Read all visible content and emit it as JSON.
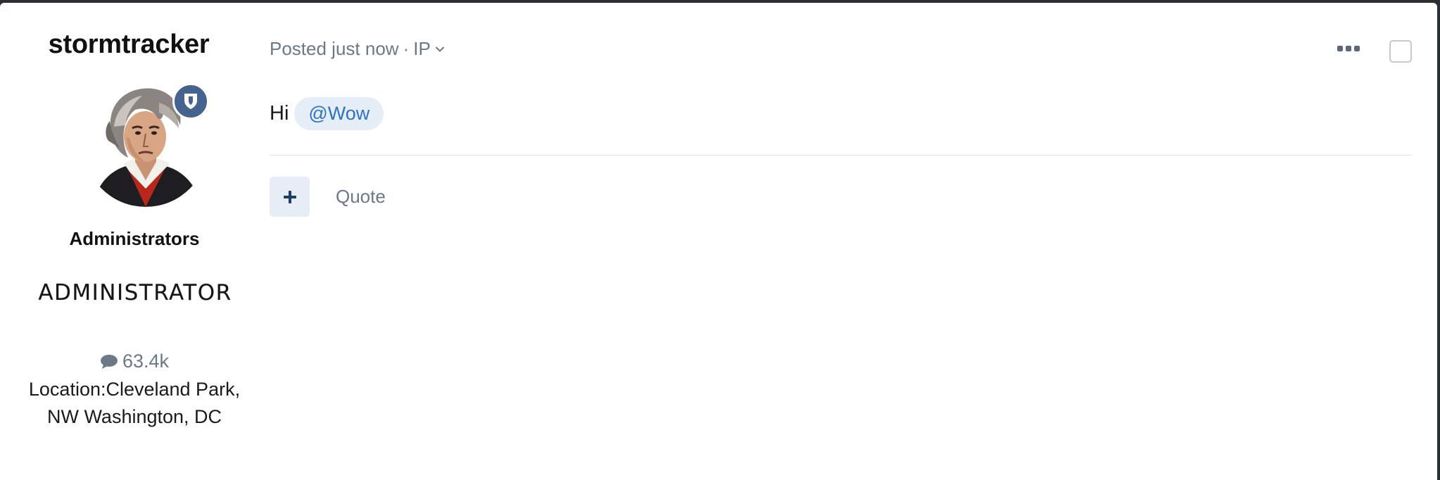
{
  "author": {
    "username": "stormtracker",
    "group": "Administrators",
    "rank_title": "ADMINISTRATOR",
    "post_count": "63.4k",
    "location_label": "Location:",
    "location_value": "Cleveland Park, NW Washington, DC",
    "badge_icon": "shield-icon",
    "badge_color": "#44638f"
  },
  "post": {
    "meta_posted": "Posted just now",
    "meta_separator": "·",
    "meta_ip": "IP",
    "content_text": "Hi",
    "mention": "@Wow",
    "quote_label": "Quote",
    "react_icon": "plus-icon",
    "more_icon": "ellipsis-icon"
  },
  "colors": {
    "accent": "#2e72c4",
    "muted_text": "#6b7888",
    "mention_bg": "#e5edf7"
  }
}
